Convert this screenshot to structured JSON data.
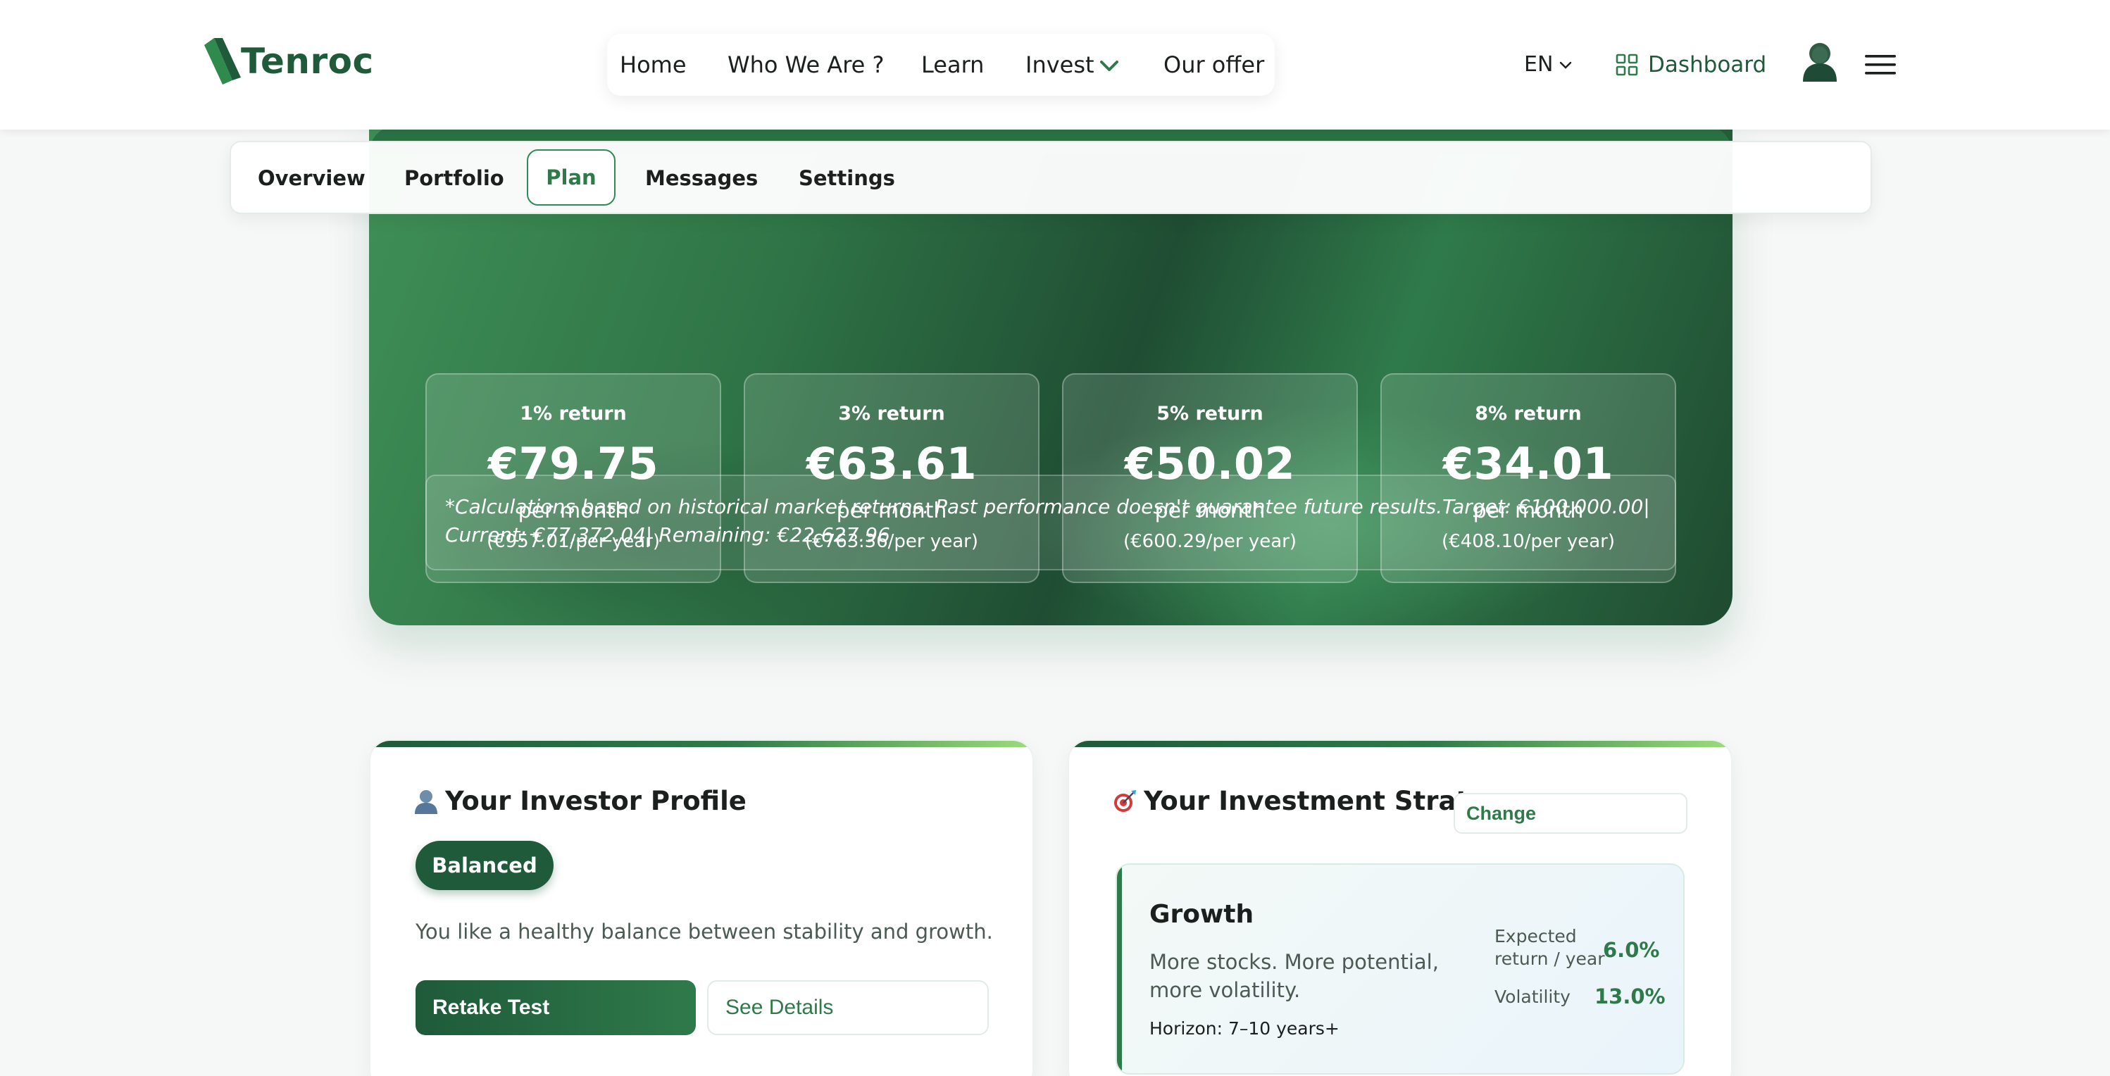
{
  "header": {
    "logo_text": "Tenroc",
    "nav": {
      "home": "Home",
      "who": "Who We Are ?",
      "learn": "Learn",
      "invest": "Invest",
      "offer": "Our offer"
    },
    "lang": "EN",
    "dashboard": "Dashboard"
  },
  "tabs": {
    "overview": "Overview",
    "portfolio": "Portfolio",
    "plan": "Plan",
    "messages": "Messages",
    "settings": "Settings",
    "active": "Plan"
  },
  "plan": {
    "returns": [
      {
        "label": "1% return",
        "value": "€79.75",
        "period": "per month",
        "yearly": "(€957.01/per year)"
      },
      {
        "label": "3% return",
        "value": "€63.61",
        "period": "per month",
        "yearly": "(€763.36/per year)"
      },
      {
        "label": "5% return",
        "value": "€50.02",
        "period": "per month",
        "yearly": "(€600.29/per year)"
      },
      {
        "label": "8% return",
        "value": "€34.01",
        "period": "per month",
        "yearly": "(€408.10/per year)"
      }
    ],
    "disclaimer": "*Calculations based on historical market returns. Past performance doesn't guarantee future results.Target: €100,000.00| Current: €77,372.04| Remaining: €22,627.96"
  },
  "profile": {
    "title": "Your Investor Profile",
    "badge": "Balanced",
    "description": "You like a healthy balance between stability and growth.",
    "retake": "Retake Test",
    "details": "See Details"
  },
  "strategy": {
    "title": "Your Investment Strategy",
    "change": "Change",
    "name": "Growth",
    "description": "More stocks. More potential, more volatility.",
    "horizon": "Horizon: 7–10 years+",
    "expected_label": "Expected return / year",
    "expected_value": "6.0%",
    "volatility_label": "Volatility",
    "volatility_value": "13.0%"
  },
  "colors": {
    "brand": "#1f5a3a",
    "accent": "#2f7a4a",
    "page_bg": "#f6f7f7"
  }
}
